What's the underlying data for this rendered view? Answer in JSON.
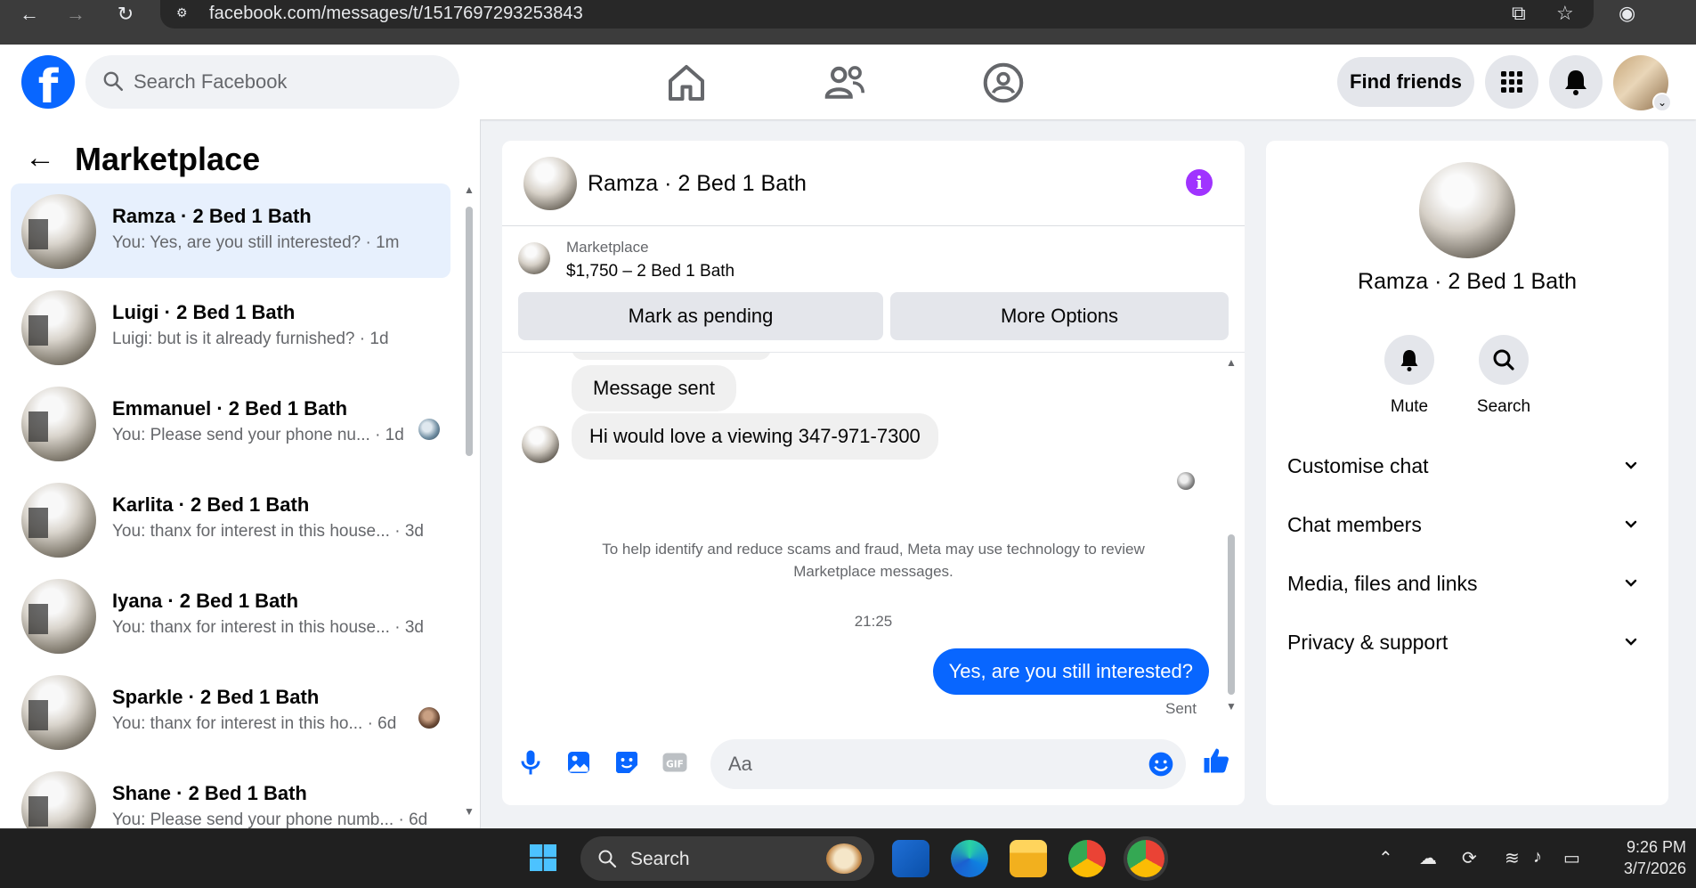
{
  "browser": {
    "url": "facebook.com/messages/t/1517697293253843"
  },
  "header": {
    "search_placeholder": "Search Facebook",
    "find_friends": "Find friends"
  },
  "left": {
    "title": "Marketplace",
    "conversations": [
      {
        "name": "Ramza · 2 Bed 1 Bath",
        "preview": "You: Yes, are you still interested? · 1m",
        "active": true
      },
      {
        "name": "Luigi · 2 Bed 1 Bath",
        "preview": "Luigi: but is it already furnished? · 1d"
      },
      {
        "name": "Emmanuel · 2 Bed 1 Bath",
        "preview": "You: Please send your phone nu...  · 1d"
      },
      {
        "name": "Karlita · 2 Bed 1 Bath",
        "preview": "You: thanx for interest in this house... · 3d"
      },
      {
        "name": "Iyana · 2 Bed 1 Bath",
        "preview": "You: thanx for interest in this house... · 3d"
      },
      {
        "name": "Sparkle · 2 Bed 1 Bath",
        "preview": "You: thanx for interest in this ho...  · 6d"
      },
      {
        "name": "Shane · 2 Bed 1 Bath",
        "preview": "You: Please send your phone numb...  · 6d"
      }
    ]
  },
  "chat": {
    "title": "Ramza · 2 Bed 1 Bath",
    "marketplace_label": "Marketplace",
    "listing": "$1,750 – 2 Bed 1 Bath",
    "mark_pending": "Mark as pending",
    "more_options": "More Options",
    "messages": {
      "m1": "Message sent",
      "m2": "Hi would love a viewing 347-971-7300",
      "notice": "To help identify and reduce scams and fraud, Meta may use technology to review Marketplace messages.",
      "time": "21:25",
      "m3": "Yes, are you still interested?",
      "status": "Sent"
    },
    "composer_placeholder": "Aa"
  },
  "details": {
    "name": "Ramza · 2 Bed 1 Bath",
    "mute": "Mute",
    "search": "Search",
    "rows": [
      "Customise chat",
      "Chat members",
      "Media, files and links",
      "Privacy & support"
    ]
  },
  "taskbar": {
    "search": "Search",
    "time": "9:26 PM",
    "date": "3/7/2026"
  },
  "colors": {
    "brand": "#0866ff",
    "info": "#a033ff",
    "active_row": "#e7f0fd"
  }
}
